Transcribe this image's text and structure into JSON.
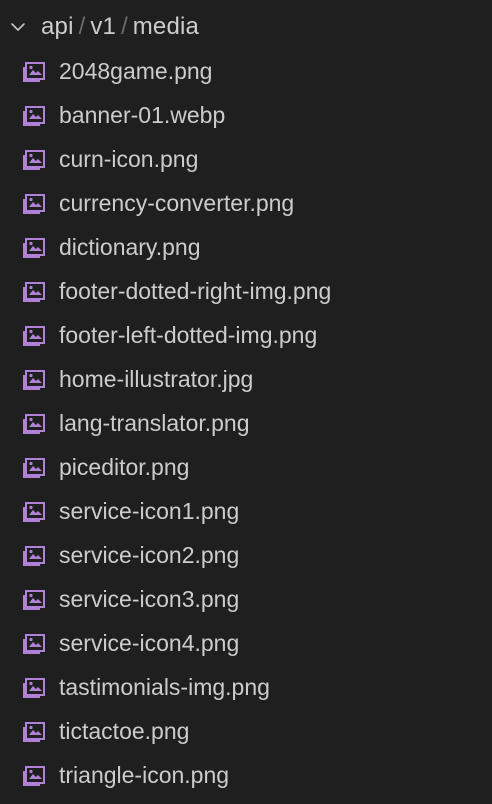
{
  "folder": {
    "path": [
      "api",
      "v1",
      "media"
    ],
    "separator": "/",
    "expanded": true
  },
  "icon_color": "#b180d7",
  "files": [
    {
      "name": "2048game.png",
      "icon": "image-file-icon"
    },
    {
      "name": "banner-01.webp",
      "icon": "image-file-icon"
    },
    {
      "name": "curn-icon.png",
      "icon": "image-file-icon"
    },
    {
      "name": "currency-converter.png",
      "icon": "image-file-icon"
    },
    {
      "name": "dictionary.png",
      "icon": "image-file-icon"
    },
    {
      "name": "footer-dotted-right-img.png",
      "icon": "image-file-icon"
    },
    {
      "name": "footer-left-dotted-img.png",
      "icon": "image-file-icon"
    },
    {
      "name": "home-illustrator.jpg",
      "icon": "image-file-icon"
    },
    {
      "name": "lang-translator.png",
      "icon": "image-file-icon"
    },
    {
      "name": "piceditor.png",
      "icon": "image-file-icon"
    },
    {
      "name": "service-icon1.png",
      "icon": "image-file-icon"
    },
    {
      "name": "service-icon2.png",
      "icon": "image-file-icon"
    },
    {
      "name": "service-icon3.png",
      "icon": "image-file-icon"
    },
    {
      "name": "service-icon4.png",
      "icon": "image-file-icon"
    },
    {
      "name": "tastimonials-img.png",
      "icon": "image-file-icon"
    },
    {
      "name": "tictactoe.png",
      "icon": "image-file-icon"
    },
    {
      "name": "triangle-icon.png",
      "icon": "image-file-icon"
    }
  ]
}
